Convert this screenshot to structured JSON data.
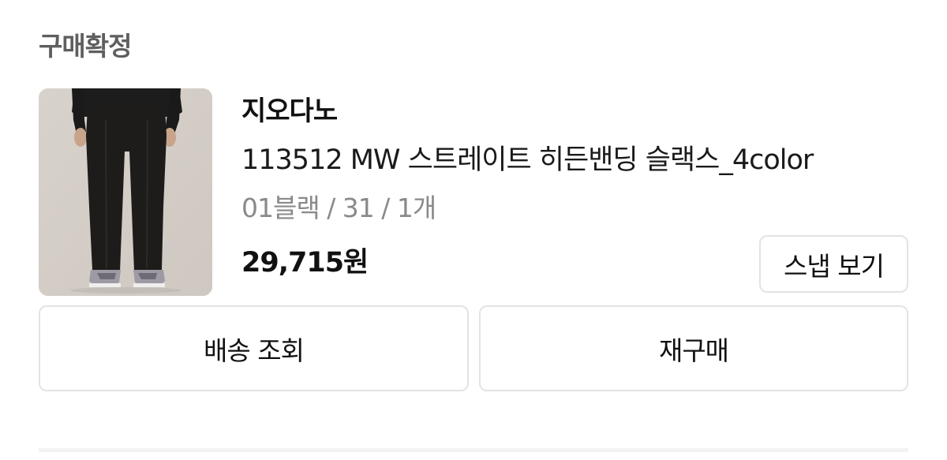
{
  "order": {
    "status": "구매확정",
    "brand": "지오다노",
    "product_name": "113512 MW 스트레이트 히든밴딩 슬랙스_4color",
    "option": "01블랙 / 31 / 1개",
    "price": "29,715원"
  },
  "buttons": {
    "snap": "스냅 보기",
    "shipping": "배송 조회",
    "rebuy": "재구매"
  },
  "colors": {
    "status_text": "#5f5f5f",
    "option_text": "#8a8a8a",
    "button_border": "#e3e3e3",
    "divider": "#f2f2f2"
  }
}
